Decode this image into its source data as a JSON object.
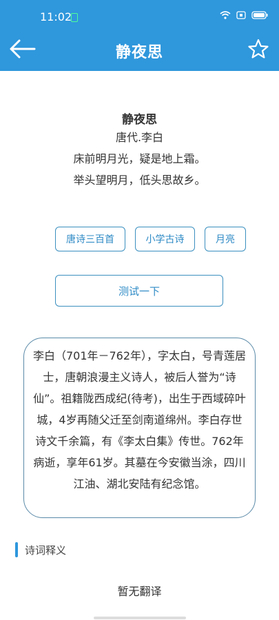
{
  "status": {
    "time": "11:02"
  },
  "header": {
    "title": "静夜思"
  },
  "poem": {
    "title": "静夜思",
    "author": "唐代.李白",
    "lines": [
      "床前明月光，疑是地上霜。",
      "举头望明月，低头思故乡。"
    ]
  },
  "tags": [
    "唐诗三百首",
    "小学古诗",
    "月亮"
  ],
  "test_button": "测试一下",
  "bio": "李白（701年－762年），字太白，号青莲居士，唐朝浪漫主义诗人，被后人誉为“诗仙”。祖籍陇西成纪(待考)，出生于西域碎叶城，4岁再随父迁至剑南道绵州。李白存世诗文千余篇，有《李太白集》传世。762年病逝，享年61岁。其墓在今安徽当涂，四川江油、湖北安陆有纪念馆。",
  "section": {
    "label": "诗词释义"
  },
  "translation_empty": "暂无翻译",
  "colors": {
    "header": "#2f97dc",
    "accent": "#2f8bc6",
    "border": "#3a8fbf"
  }
}
